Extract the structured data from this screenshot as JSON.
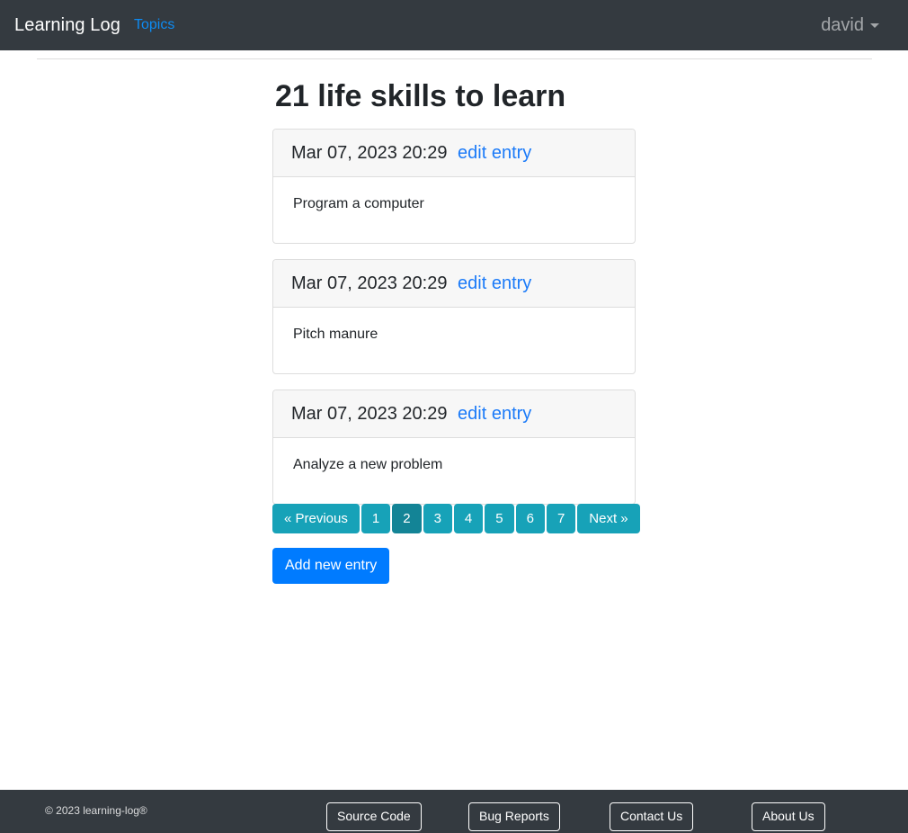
{
  "navbar": {
    "brand": "Learning Log",
    "links": [
      {
        "label": "Topics",
        "name": "nav-link-topics"
      }
    ],
    "user": "david",
    "caret_icon": "chevron-down-icon",
    "background_color": "#343a40",
    "link_color": "#0d8bf2"
  },
  "main": {
    "title": "21 life skills to learn",
    "entries": [
      {
        "date": "Mar 07, 2023 20:29",
        "edit_label": "edit entry",
        "text": "Program a computer"
      },
      {
        "date": "Mar 07, 2023 20:29",
        "edit_label": "edit entry",
        "text": "Pitch manure"
      },
      {
        "date": "Mar 07, 2023 20:29",
        "edit_label": "edit entry",
        "text": "Analyze a new problem"
      }
    ],
    "pagination": {
      "previous_label": "« Previous",
      "next_label": "Next »",
      "pages": [
        "1",
        "2",
        "3",
        "4",
        "5",
        "6",
        "7"
      ],
      "active_page": "2",
      "color": "#17a2b8",
      "active_color": "#138496"
    },
    "add_entry_label": "Add new entry",
    "add_entry_color": "#007bff"
  },
  "footer": {
    "copyright": "© 2023 learning-log®",
    "buttons": [
      {
        "label": "Source Code",
        "name": "footer-button-source-code"
      },
      {
        "label": "Bug Reports",
        "name": "footer-button-bug-reports"
      },
      {
        "label": "Contact Us",
        "name": "footer-button-contact-us"
      },
      {
        "label": "About Us",
        "name": "footer-button-about-us"
      }
    ],
    "background_color": "#343a40"
  }
}
